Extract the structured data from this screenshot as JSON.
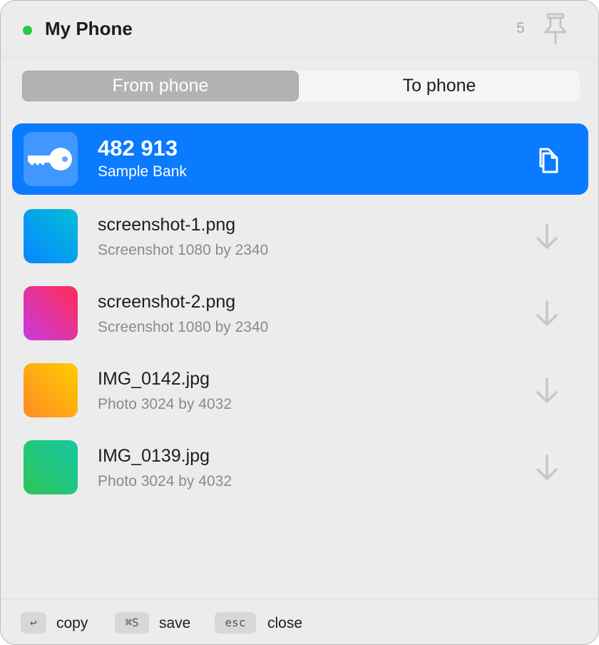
{
  "header": {
    "device_name": "My Phone",
    "status_color": "#28c840",
    "count": "5",
    "pin_icon": "pin-icon"
  },
  "tabs": [
    {
      "label": "From phone",
      "active": true
    },
    {
      "label": "To phone",
      "active": false
    }
  ],
  "items": [
    {
      "title": "482 913",
      "subtitle": "Sample Bank",
      "icon": "key-icon",
      "action_icon": "copy-icon",
      "selected": true,
      "accent": "#0a7aff"
    },
    {
      "title": "screenshot-1.png",
      "subtitle": "Screenshot  1080 by 2340",
      "action_icon": "download-arrow-icon",
      "gradient": [
        "#0a84ff",
        "#00c0d8"
      ]
    },
    {
      "title": "screenshot-2.png",
      "subtitle": "Screenshot  1080 by 2340",
      "action_icon": "download-arrow-icon",
      "gradient": [
        "#c63be0",
        "#ff2d55"
      ]
    },
    {
      "title": "IMG_0142.jpg",
      "subtitle": "Photo  3024 by 4032",
      "action_icon": "download-arrow-icon",
      "gradient": [
        "#ff8a24",
        "#ffcc00"
      ]
    },
    {
      "title": "IMG_0139.jpg",
      "subtitle": "Photo  3024 by 4032",
      "action_icon": "download-arrow-icon",
      "gradient": [
        "#2ec45a",
        "#14c8a0"
      ]
    }
  ],
  "footer": {
    "shortcuts": [
      {
        "key": "↩",
        "label": "copy"
      },
      {
        "key": "⌘S",
        "label": "save"
      },
      {
        "key": "esc",
        "label": "close"
      }
    ]
  }
}
